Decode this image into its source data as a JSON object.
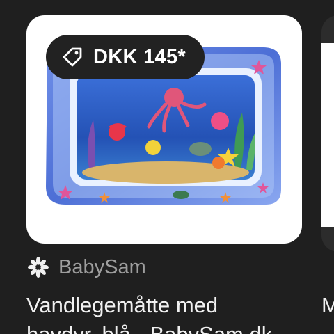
{
  "product": {
    "price": "DKK 145*",
    "seller": "BabySam",
    "title": "Vandlegemåtte med\nhavdyr, blå - BabySam.dk",
    "image_icon": "water-play-mat-image"
  },
  "next_product": {
    "title_fragment": "M"
  },
  "icons": {
    "price": "tag-icon",
    "seller": "seller-logo-icon"
  },
  "colors": {
    "background": "#1f1f1f",
    "card": "#ffffff",
    "pill": "#222222",
    "seller_text": "#9e9e9e",
    "title_text": "#f1f1f1"
  }
}
